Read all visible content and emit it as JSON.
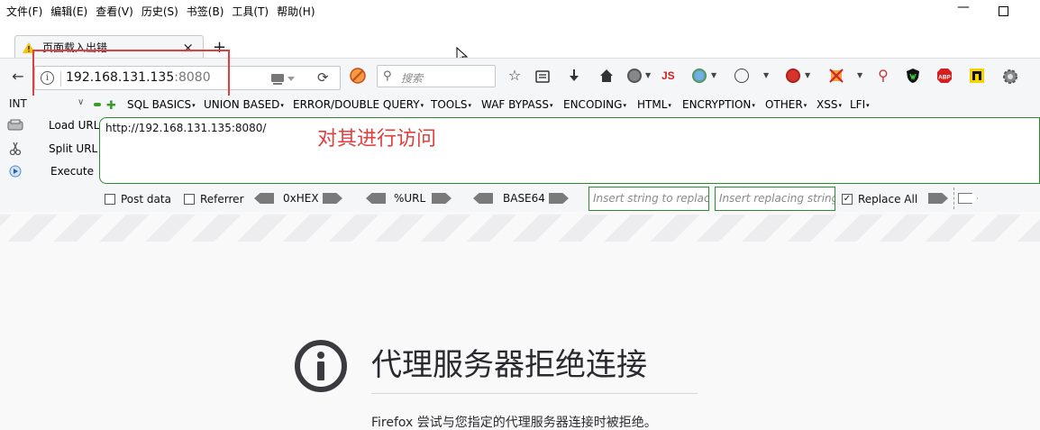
{
  "menubar": {
    "items": [
      "文件(F)",
      "编辑(E)",
      "查看(V)",
      "历史(S)",
      "书签(B)",
      "工具(T)",
      "帮助(H)"
    ]
  },
  "tab": {
    "title": "页面载入出错",
    "close": "×"
  },
  "newtab": "+",
  "urlbar": {
    "host": "192.168.131.135",
    "port": ":8080"
  },
  "search": {
    "placeholder": "搜索"
  },
  "icons": {
    "js": "JS"
  },
  "hackbar": {
    "select": "INT",
    "menus": [
      "SQL BASICS",
      "UNION BASED",
      "ERROR/DOUBLE QUERY",
      "TOOLS",
      "WAF BYPASS",
      "ENCODING",
      "HTML",
      "ENCRYPTION",
      "OTHER",
      "XSS",
      "LFI"
    ],
    "load_url": "Load URL",
    "split_url": "Split URL",
    "execute": "Execute",
    "url_value": "http://192.168.131.135:8080/",
    "post_data": "Post data",
    "referrer": "Referrer",
    "hex": "0xHEX",
    "url_enc": "%URL",
    "base64": "BASE64",
    "insert_ph": "Insert string to replace",
    "replacing_ph": "Insert replacing string",
    "replace_all": "Replace All"
  },
  "annotation": "对其进行访问",
  "error": {
    "title": "代理服务器拒绝连接",
    "description": "Firefox 尝试与您指定的代理服务器连接时被拒绝。"
  },
  "colors": {
    "annotation_red": "#e23e3e",
    "hackbar_green": "#2f8a2f"
  }
}
